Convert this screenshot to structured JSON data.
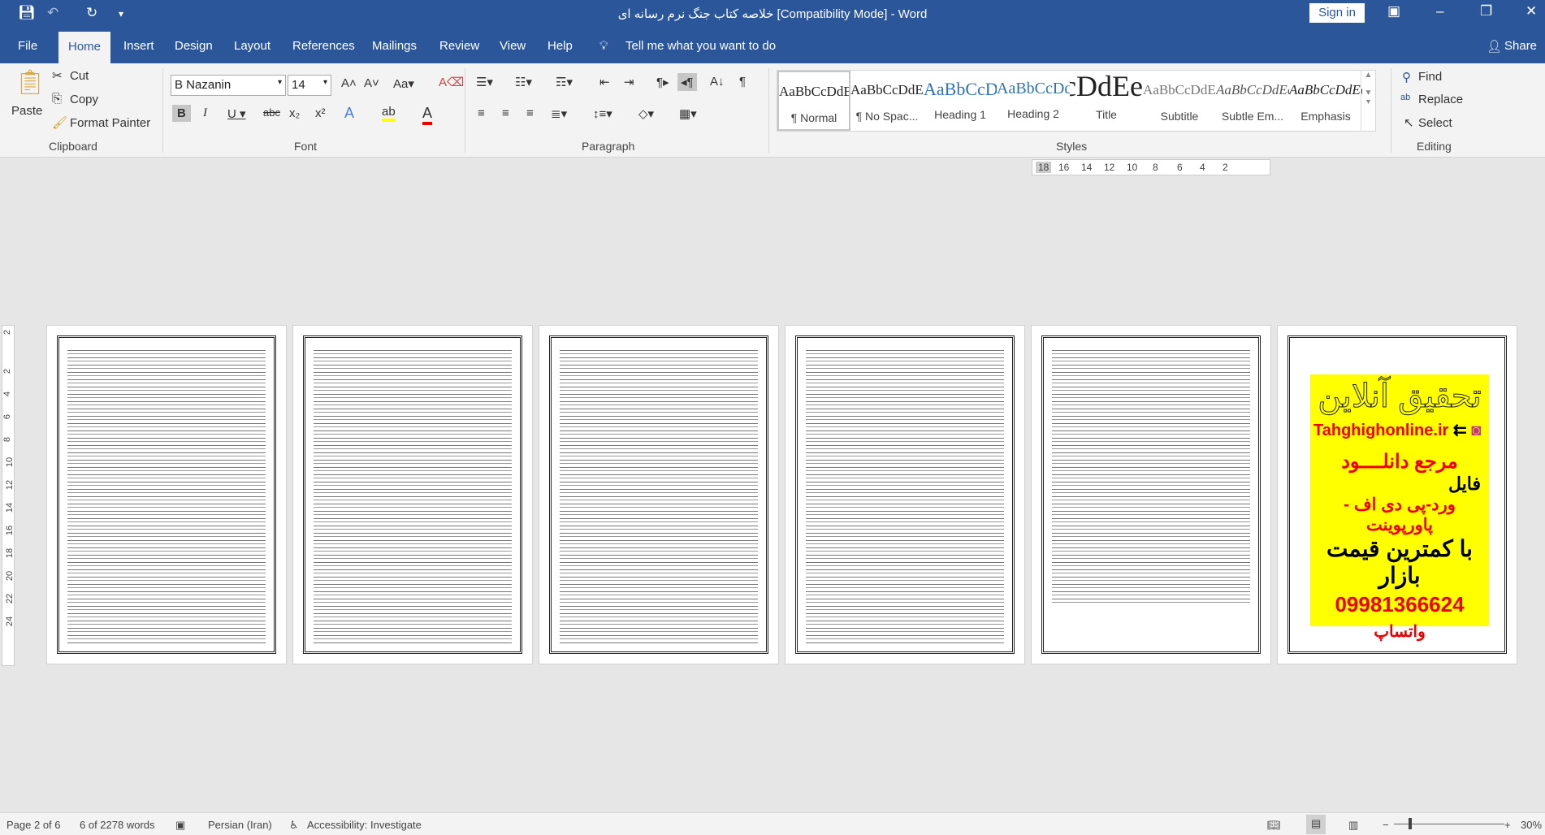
{
  "window": {
    "title": "خلاصه کتاب جنگ نرم رسانه ای [Compatibility Mode]  -  Word",
    "sign_in": "Sign in"
  },
  "tabs": [
    "File",
    "Home",
    "Insert",
    "Design",
    "Layout",
    "References",
    "Mailings",
    "Review",
    "View",
    "Help"
  ],
  "tell_me": "Tell me what you want to do",
  "share": "Share",
  "clipboard": {
    "paste": "Paste",
    "cut": "Cut",
    "copy": "Copy",
    "format_painter": "Format Painter",
    "group": "Clipboard"
  },
  "font": {
    "name": "B Nazanin",
    "size": "14",
    "group": "Font"
  },
  "paragraph": {
    "group": "Paragraph"
  },
  "styles": {
    "group": "Styles",
    "items": [
      {
        "preview": "AaBbCcDdEe",
        "label": "¶ Normal"
      },
      {
        "preview": "AaBbCcDdEe",
        "label": "¶ No Spac..."
      },
      {
        "preview": "AaBbCcDdEe",
        "label": "Heading 1"
      },
      {
        "preview": "AaBbCcDdEe",
        "label": "Heading 2"
      },
      {
        "preview": "AaBbCcDdEe",
        "label": "Title"
      },
      {
        "preview": "AaBbCcDdEe",
        "label": "Subtitle"
      },
      {
        "preview": "AaBbCcDdEe",
        "label": "Subtle Em..."
      },
      {
        "preview": "AaBbCcDdEe",
        "label": "Emphasis"
      }
    ]
  },
  "editing": {
    "find": "Find",
    "replace": "Replace",
    "select": "Select",
    "group": "Editing"
  },
  "ruler": [
    "18",
    "16",
    "14",
    "12",
    "10",
    "8",
    "6",
    "4",
    "2"
  ],
  "vruler": [
    "2",
    "2",
    "4",
    "6",
    "8",
    "10",
    "12",
    "14",
    "16",
    "18",
    "20",
    "22",
    "24"
  ],
  "ad": {
    "title": "تحقیق آنلاین",
    "site": "Tahghighonline.ir",
    "line1": "مرجع دانلــــود",
    "line2": "فایل",
    "line3": "ورد-پی دی اف - پاورپوینت",
    "line4": "با کمترین قیمت بازار",
    "phone": "09981366624",
    "whatsapp": "واتساپ"
  },
  "status": {
    "page": "Page 2 of 6",
    "words": "6 of 2278 words",
    "language": "Persian (Iran)",
    "accessibility": "Accessibility: Investigate",
    "zoom": "30%"
  }
}
